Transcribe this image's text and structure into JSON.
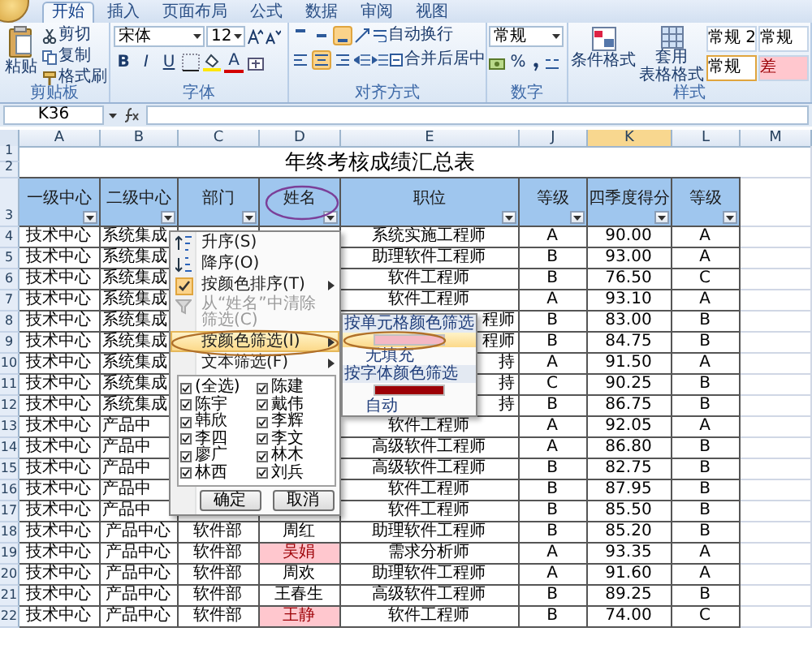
{
  "ribbon": {
    "tabs": [
      {
        "label": "开始",
        "selected": true
      },
      {
        "label": "插入",
        "selected": false
      },
      {
        "label": "页面布局",
        "selected": false
      },
      {
        "label": "公式",
        "selected": false
      },
      {
        "label": "数据",
        "selected": false
      },
      {
        "label": "审阅",
        "selected": false
      },
      {
        "label": "视图",
        "selected": false
      }
    ],
    "clipboard": {
      "label": "剪贴板",
      "paste": "粘贴",
      "tools": [
        {
          "label": "剪切",
          "kind": "cut"
        },
        {
          "label": "复制",
          "kind": "copy"
        },
        {
          "label": "格式刷",
          "kind": "brush"
        }
      ]
    },
    "font": {
      "label": "字体",
      "family": "宋体",
      "size": "12",
      "styles": [
        "B",
        "I",
        "U"
      ],
      "color_letter": "A"
    },
    "alignment": {
      "label": "对齐方式",
      "vertical": [
        {
          "selected": false
        },
        {
          "selected": false
        },
        {
          "selected": true
        }
      ],
      "horizontal": [
        {
          "selected": false
        },
        {
          "selected": true
        },
        {
          "selected": false
        }
      ],
      "wrap": "自动换行",
      "merge": "合并后居中"
    },
    "number": {
      "label": "数字",
      "format": "常规",
      "percent": "%"
    },
    "styles": {
      "label": "样式",
      "conditional": "条件格式",
      "table_format": [
        "套用",
        "表格格式"
      ],
      "cells": [
        {
          "label": "常规 2",
          "kind": "normal",
          "selected": false
        },
        {
          "label": "常规",
          "kind": "normal",
          "selected": false
        },
        {
          "label": "常规",
          "kind": "normal",
          "selected": true
        },
        {
          "label": "差",
          "kind": "bad",
          "selected": false
        }
      ]
    }
  },
  "formula_bar": {
    "name_box": "K36"
  },
  "sheet": {
    "columns": [
      {
        "label": "A",
        "selected": false
      },
      {
        "label": "B",
        "selected": false
      },
      {
        "label": "C",
        "selected": false
      },
      {
        "label": "D",
        "selected": false
      },
      {
        "label": "E",
        "selected": false
      },
      {
        "label": "J",
        "selected": false
      },
      {
        "label": "K",
        "selected": true
      },
      {
        "label": "L",
        "selected": false
      },
      {
        "label": "M",
        "selected": false
      }
    ],
    "top_rows": [
      "1",
      "2",
      "3"
    ],
    "title": "年终考核成绩汇总表",
    "headers": [
      "一级中心",
      "二级中心",
      "部门",
      "姓名",
      "职位",
      "等级",
      "四季度得分",
      "等级"
    ],
    "rows": [
      {
        "number": "4",
        "cells": [
          "技术中心",
          {
            "text": "系统集成",
            "cut_end": true
          },
          null,
          null,
          "系统实施工程师",
          "A",
          "90.00",
          "A"
        ]
      },
      {
        "number": "5",
        "cells": [
          "技术中心",
          {
            "text": "系统集成",
            "cut_end": true
          },
          null,
          null,
          "助理软件工程师",
          "B",
          "93.00",
          "A"
        ]
      },
      {
        "number": "6",
        "cells": [
          "技术中心",
          {
            "text": "系统集成",
            "cut_end": true
          },
          null,
          null,
          "软件工程师",
          "B",
          "76.50",
          "C"
        ]
      },
      {
        "number": "7",
        "cells": [
          "技术中心",
          {
            "text": "系统集成",
            "cut_end": true
          },
          null,
          null,
          "软件工程师",
          "A",
          "93.10",
          "A"
        ]
      },
      {
        "number": "8",
        "cells": [
          "技术中心",
          {
            "text": "系统集成",
            "cut_end": true
          },
          null,
          null,
          {
            "text": "程师",
            "cut_start": true
          },
          "B",
          "83.00",
          "B"
        ]
      },
      {
        "number": "9",
        "cells": [
          "技术中心",
          {
            "text": "系统集成",
            "cut_end": true
          },
          null,
          null,
          {
            "text": "程师",
            "cut_start": true
          },
          "B",
          "84.75",
          "B"
        ]
      },
      {
        "number": "10",
        "cells": [
          "技术中心",
          {
            "text": "系统集成",
            "cut_end": true
          },
          null,
          null,
          {
            "text": "持",
            "cut_start": true
          },
          "A",
          "91.50",
          "A"
        ]
      },
      {
        "number": "11",
        "cells": [
          "技术中心",
          {
            "text": "系统集成",
            "cut_end": true
          },
          null,
          null,
          {
            "text": "持",
            "cut_start": true
          },
          "C",
          "90.25",
          "B"
        ]
      },
      {
        "number": "12",
        "cells": [
          "技术中心",
          {
            "text": "系统集成",
            "cut_end": true
          },
          null,
          null,
          {
            "text": "持",
            "cut_start": true
          },
          "B",
          "86.75",
          "B"
        ]
      },
      {
        "number": "13",
        "cells": [
          "技术中心",
          {
            "text": "产品中",
            "cut_end": true
          },
          null,
          null,
          "软件工程师",
          "A",
          "92.05",
          "A"
        ]
      },
      {
        "number": "14",
        "cells": [
          "技术中心",
          {
            "text": "产品中",
            "cut_end": true
          },
          null,
          null,
          "高级软件工程师",
          "A",
          "86.80",
          "B"
        ]
      },
      {
        "number": "15",
        "cells": [
          "技术中心",
          {
            "text": "产品中",
            "cut_end": true
          },
          null,
          null,
          "高级软件工程师",
          "B",
          "82.75",
          "B"
        ]
      },
      {
        "number": "16",
        "cells": [
          "技术中心",
          {
            "text": "产品中",
            "cut_end": true
          },
          null,
          null,
          "软件工程师",
          "B",
          "87.95",
          "B"
        ]
      },
      {
        "number": "17",
        "cells": [
          "技术中心",
          {
            "text": "产品中",
            "cut_end": true
          },
          null,
          null,
          "软件工程师",
          "B",
          "85.50",
          "B"
        ]
      },
      {
        "number": "18",
        "cells": [
          "技术中心",
          "产品中心",
          "软件部",
          "周红",
          "助理软件工程师",
          "B",
          "85.20",
          "B"
        ]
      },
      {
        "number": "19",
        "cells": [
          "技术中心",
          "产品中心",
          "软件部",
          {
            "text": "吴娟",
            "marked": true
          },
          "需求分析师",
          "A",
          "93.35",
          "A"
        ]
      },
      {
        "number": "20",
        "cells": [
          "技术中心",
          "产品中心",
          "软件部",
          "周欢",
          "助理软件工程师",
          "A",
          "91.60",
          "A"
        ]
      },
      {
        "number": "21",
        "cells": [
          "技术中心",
          "产品中心",
          "软件部",
          "王春生",
          "高级软件工程师",
          "B",
          "89.25",
          "B"
        ]
      },
      {
        "number": "22",
        "cells": [
          "技术中心",
          "产品中心",
          "软件部",
          {
            "text": "王静",
            "marked": true
          },
          "软件工程师",
          "B",
          "74.00",
          "C"
        ]
      }
    ]
  },
  "filter_menu": {
    "items": [
      {
        "label": "升序(S)",
        "kind": "sort_asc",
        "disabled": false,
        "highlighted": false,
        "submenu": false
      },
      {
        "label": "降序(O)",
        "kind": "sort_desc",
        "disabled": false,
        "highlighted": false,
        "submenu": false
      },
      {
        "label": "按颜色排序(T)",
        "kind": "color_sort",
        "disabled": false,
        "highlighted": false,
        "submenu": true
      },
      {
        "label": "从“姓名”中清除筛选(C)",
        "kind": "clear",
        "disabled": true,
        "highlighted": false,
        "submenu": false
      },
      {
        "label": "按颜色筛选(I)",
        "kind": "color_filter",
        "disabled": false,
        "highlighted": true,
        "submenu": true
      },
      {
        "label": "文本筛选(F)",
        "kind": "text_filter",
        "disabled": false,
        "highlighted": false,
        "submenu": true
      }
    ],
    "values": [
      {
        "label": "(全选)",
        "checked": true
      },
      {
        "label": "陈建",
        "checked": true
      },
      {
        "label": "陈宇",
        "checked": true
      },
      {
        "label": "戴伟",
        "checked": true
      },
      {
        "label": "韩欣",
        "checked": true
      },
      {
        "label": "李辉",
        "checked": true
      },
      {
        "label": "李四",
        "checked": true
      },
      {
        "label": "李文",
        "checked": true
      },
      {
        "label": "廖广",
        "checked": true
      },
      {
        "label": "林木",
        "checked": true
      },
      {
        "label": "林西",
        "checked": true
      },
      {
        "label": "刘兵",
        "checked": true
      }
    ],
    "buttons": [
      "确定",
      "取消"
    ]
  },
  "color_submenu": {
    "sections": [
      {
        "heading": "按单元格颜色筛选",
        "swatch": {
          "color": "#f4b8c4",
          "selected": true
        },
        "option": "无填充"
      },
      {
        "heading": "按字体颜色筛选",
        "swatch": {
          "color": "#9c0006",
          "selected": false
        },
        "option": "自动"
      }
    ]
  }
}
